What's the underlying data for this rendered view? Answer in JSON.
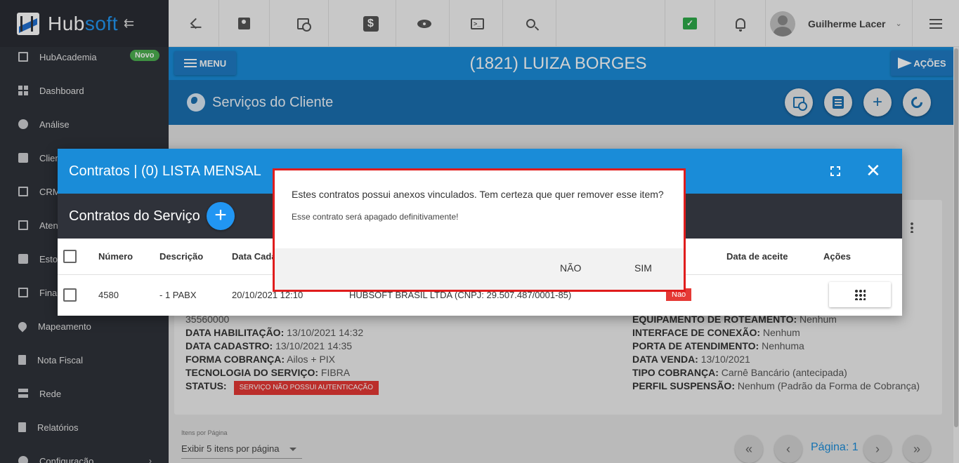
{
  "brand": {
    "name_part1": "Hub",
    "name_part2": "soft"
  },
  "sidebar": {
    "items": [
      {
        "label": "HubAcademia",
        "badge": "Novo",
        "icon": "book-icon"
      },
      {
        "label": "Dashboard",
        "icon": "grid-icon"
      },
      {
        "label": "Análise",
        "icon": "pie-chart-icon"
      },
      {
        "label": "Clientes",
        "icon": "contact-card-icon"
      },
      {
        "label": "CRM",
        "icon": "kanban-icon"
      },
      {
        "label": "Atendimento",
        "icon": "calendar-clock-icon"
      },
      {
        "label": "Estoque",
        "icon": "box-icon"
      },
      {
        "label": "Financeiro",
        "icon": "dollar-icon"
      },
      {
        "label": "Mapeamento",
        "icon": "map-pin-icon"
      },
      {
        "label": "Nota Fiscal",
        "icon": "document-icon"
      },
      {
        "label": "Rede",
        "icon": "server-icon"
      },
      {
        "label": "Relatórios",
        "icon": "report-icon"
      },
      {
        "label": "Configuração",
        "icon": "gear-icon"
      }
    ]
  },
  "topbar": {
    "user_name": "Guilherme Lacer",
    "dollar_glyph": "$",
    "terminal_glyph": ">_",
    "chat_glyph": "✓"
  },
  "client": {
    "menu_label": "MENU",
    "title": "(1821) LUIZA BORGES",
    "actions_label": "AÇÕES"
  },
  "services": {
    "title": "Serviços do Cliente"
  },
  "details_left": [
    {
      "label": "",
      "value": "35560000"
    },
    {
      "label": "DATA HABILITAÇÃO:",
      "value": "13/10/2021 14:32"
    },
    {
      "label": "DATA CADASTRO:",
      "value": "13/10/2021 14:35"
    },
    {
      "label": "FORMA COBRANÇA:",
      "value": "Ailos + PIX"
    },
    {
      "label": "TECNOLOGIA DO SERVIÇO:",
      "value": "FIBRA"
    },
    {
      "label": "STATUS:",
      "value": "SERVIÇO NÃO POSSUI AUTENTICAÇÃO"
    }
  ],
  "details_right": [
    {
      "label": "EQUIPAMENTO DE ROTEAMENTO:",
      "value": "Nenhum"
    },
    {
      "label": "INTERFACE DE CONEXÃO:",
      "value": "Nenhum"
    },
    {
      "label": "PORTA DE ATENDIMENTO:",
      "value": "Nenhuma"
    },
    {
      "label": "DATA VENDA:",
      "value": "13/10/2021"
    },
    {
      "label": "TIPO COBRANÇA:",
      "value": "Carnê Bancário (antecipada)"
    },
    {
      "label": "PERFIL SUSPENSÃO:",
      "value": "Nenhum (Padrão da Forma de Cobrança)"
    }
  ],
  "pager": {
    "items_label": "Itens por Página",
    "items_value": "Exibir 5 itens por página",
    "page_text": "Página: 1",
    "first": "«",
    "prev": "‹",
    "next": "›",
    "last": "»"
  },
  "modal": {
    "title": "Contratos | (0) LISTA MENSAL",
    "close_glyph": "✕",
    "subtitle": "Contratos do Serviço",
    "add_glyph": "+",
    "columns": {
      "numero": "Número",
      "descricao": "Descrição",
      "data_cadastro": "Data Cadastro",
      "data_aceite": "Data de aceite",
      "acoes": "Ações"
    },
    "row": {
      "numero": "4580",
      "descricao": "- 1 PABX",
      "data_cadastro": "20/10/2021 12:10",
      "empresa": "HUBSOFT BRASIL LTDA (CNPJ: 29.507.487/0001-85)",
      "aceite": "Não"
    }
  },
  "confirm": {
    "question": "Estes contratos possui anexos vinculados. Tem certeza que quer remover esse item?",
    "message": "Esse contrato será apagado definitivamente!",
    "no_label": "NÃO",
    "yes_label": "SIM"
  }
}
